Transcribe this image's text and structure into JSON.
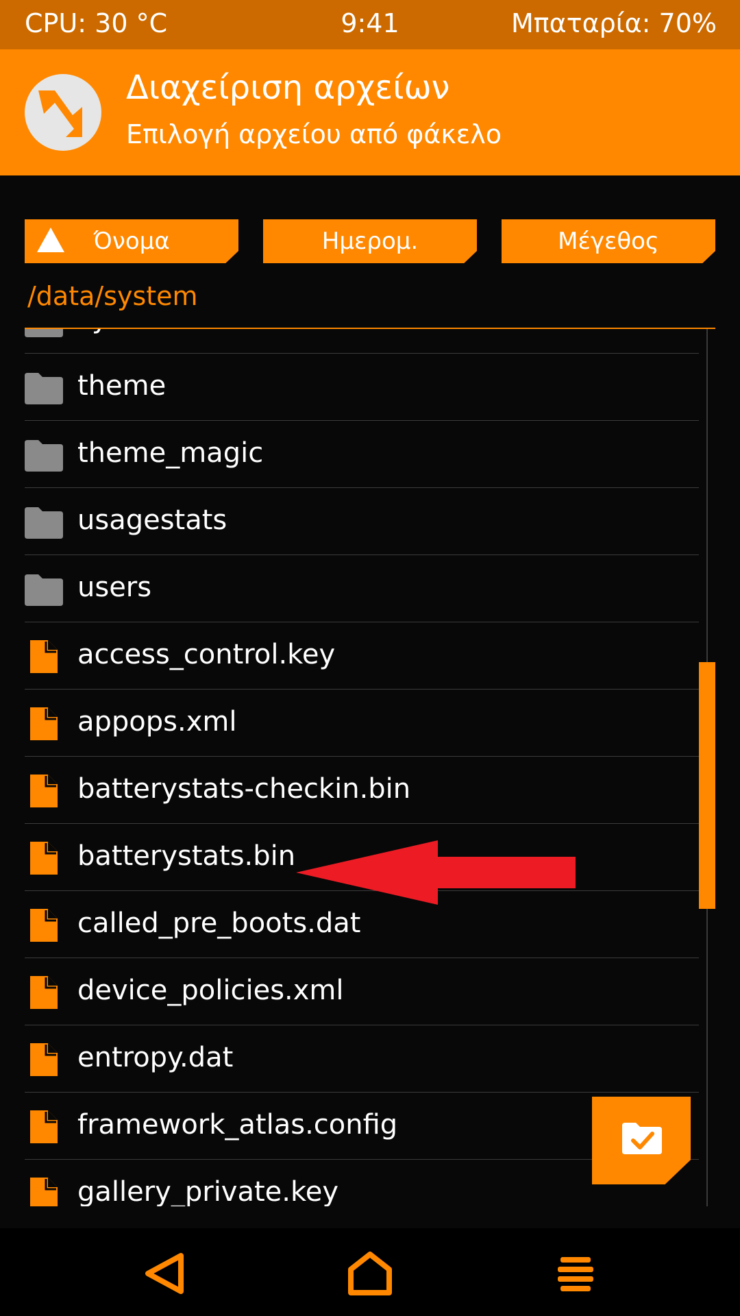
{
  "status_bar": {
    "cpu": "CPU: 30 °C",
    "time": "9:41",
    "battery": "Μπαταρία: 70%"
  },
  "header": {
    "title": "Διαχείριση αρχείων",
    "subtitle": "Επιλογή αρχείου από φάκελο"
  },
  "sort_buttons": {
    "name": "Όνομα",
    "date": "Ημερομ.",
    "size": "Μέγεθος"
  },
  "path": "/data/system",
  "files": [
    {
      "name": "sync",
      "type": "folder"
    },
    {
      "name": "theme",
      "type": "folder"
    },
    {
      "name": "theme_magic",
      "type": "folder"
    },
    {
      "name": "usagestats",
      "type": "folder"
    },
    {
      "name": "users",
      "type": "folder"
    },
    {
      "name": "access_control.key",
      "type": "file"
    },
    {
      "name": "appops.xml",
      "type": "file"
    },
    {
      "name": "batterystats-checkin.bin",
      "type": "file"
    },
    {
      "name": "batterystats.bin",
      "type": "file"
    },
    {
      "name": "called_pre_boots.dat",
      "type": "file"
    },
    {
      "name": "device_policies.xml",
      "type": "file"
    },
    {
      "name": "entropy.dat",
      "type": "file"
    },
    {
      "name": "framework_atlas.config",
      "type": "file"
    },
    {
      "name": "gallery_private.key",
      "type": "file"
    }
  ],
  "colors": {
    "accent": "#ff8800",
    "status_bar": "#cc6a00",
    "background": "#080808",
    "folder_icon": "#8a8a8a",
    "annotation_arrow": "#ed1c24"
  },
  "icons": {
    "logo": "twrp-logo-icon",
    "sort": "triangle-up-icon",
    "folder": "folder-icon",
    "file": "file-icon",
    "fab": "folder-check-icon",
    "back": "back-triangle-icon",
    "home": "home-icon",
    "menu": "menu-icon"
  }
}
